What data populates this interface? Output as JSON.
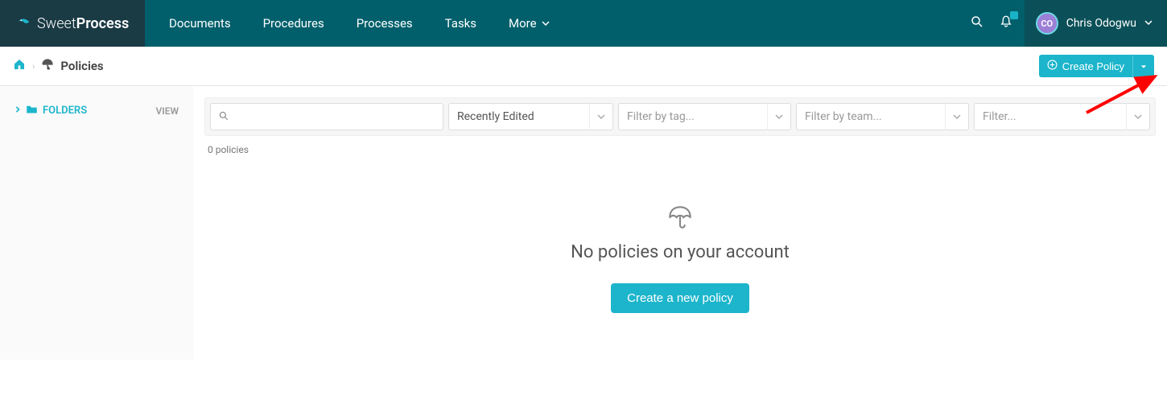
{
  "brand": {
    "part1": "Sweet",
    "part2": "Process"
  },
  "nav": {
    "documents": "Documents",
    "procedures": "Procedures",
    "processes": "Processes",
    "tasks": "Tasks",
    "more": "More"
  },
  "user": {
    "initials": "CO",
    "name": "Chris Odogwu"
  },
  "breadcrumb": {
    "title": "Policies"
  },
  "create_button": {
    "label": "Create Policy"
  },
  "sidebar": {
    "folders_label": "FOLDERS",
    "view_label": "VIEW"
  },
  "filters": {
    "search_placeholder": "",
    "recently_edited": "Recently Edited",
    "filter_tag_placeholder": "Filter by tag...",
    "filter_team_placeholder": "Filter by team...",
    "filter_placeholder": "Filter..."
  },
  "count_label": "0 policies",
  "empty": {
    "title": "No policies on your account",
    "button": "Create a new policy"
  },
  "colors": {
    "accent": "#1cb5cb",
    "header": "#005f6b",
    "header_dark": "#1a3a44"
  }
}
